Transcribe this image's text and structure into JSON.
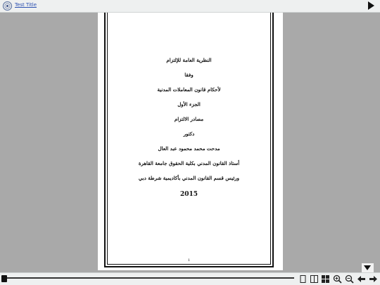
{
  "app": {
    "title": "Test Title"
  },
  "icons": {
    "logo": "ornate-logo-icon",
    "play": "play-icon",
    "scroll_down": "arrow-down-icon",
    "single_page": "single-page-icon",
    "two_page": "two-page-icon",
    "thumbnails": "grid-icon",
    "zoom_in": "zoom-in-icon",
    "zoom_out": "zoom-out-icon",
    "prev": "arrow-left-icon",
    "next": "arrow-right-icon",
    "slider_handle": "pointer-icon"
  },
  "document": {
    "lines": [
      "النظرية العامة للإلتزام",
      "وفقا",
      "لأحكام قانون المعاملات المدنية",
      "الجزء الأول",
      "مصادر الالتزام",
      "دكتور",
      "مدحت محمد محمود عبد العال",
      "أستاذ القانون المدني بكلية الحقوق جامعة القاهرة",
      "ورئيس قسم القانون المدني بأكاديمية شرطة دبي"
    ],
    "year": "2015",
    "page_number": "1"
  },
  "colors": {
    "viewer_bg": "#a9a9a9",
    "toolbar_bg": "#eef0f0",
    "link": "#2a4fb0"
  }
}
